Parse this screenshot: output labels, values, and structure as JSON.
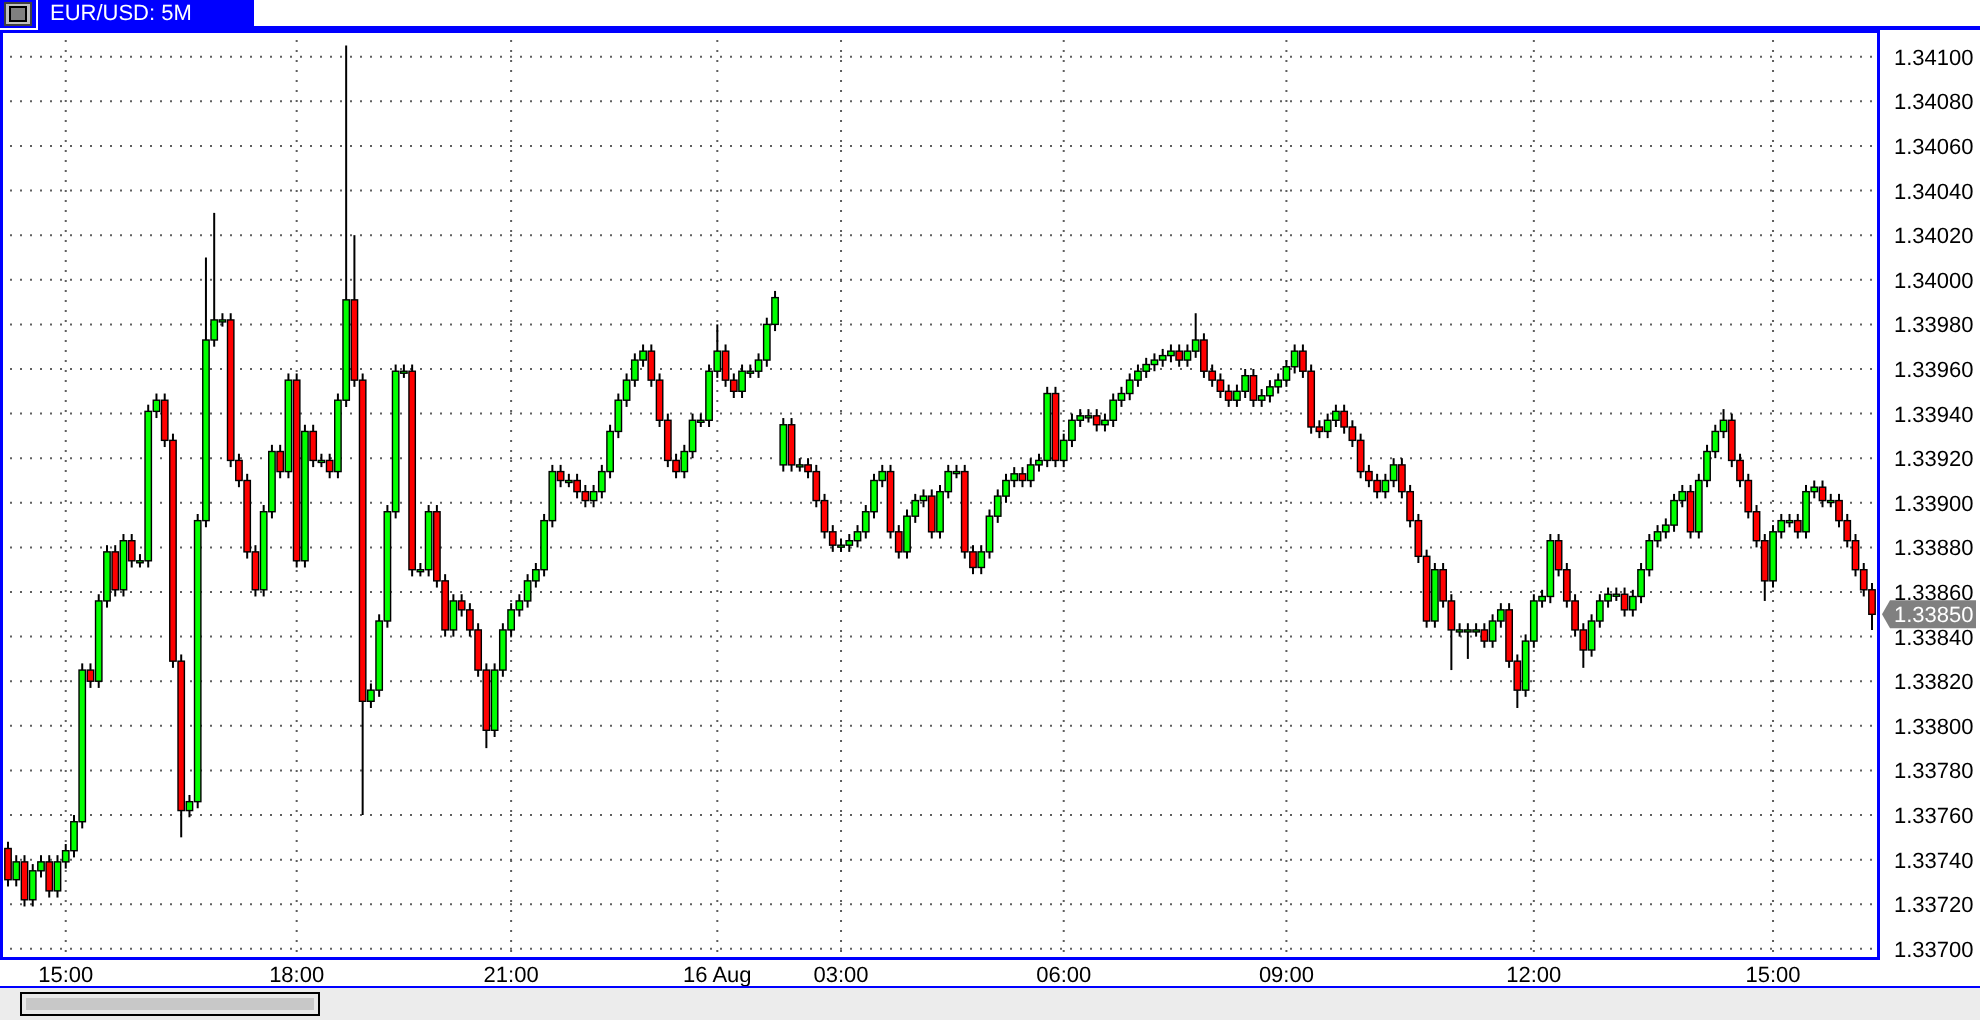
{
  "chart": {
    "title": "EUR/USD: 5M",
    "current_price": "1.33850",
    "chart_data": {
      "type": "candlestick",
      "grid": true,
      "ylim": [
        1.33695,
        1.34112
      ],
      "yticks": [
        {
          "value": 1.337,
          "label": "1.33700"
        },
        {
          "value": 1.3372,
          "label": "1.33720"
        },
        {
          "value": 1.3374,
          "label": "1.33740"
        },
        {
          "value": 1.3376,
          "label": "1.33760"
        },
        {
          "value": 1.3378,
          "label": "1.33780"
        },
        {
          "value": 1.338,
          "label": "1.33800"
        },
        {
          "value": 1.3382,
          "label": "1.33820"
        },
        {
          "value": 1.3384,
          "label": "1.33840"
        },
        {
          "value": 1.3386,
          "label": "1.33860"
        },
        {
          "value": 1.3388,
          "label": "1.33880"
        },
        {
          "value": 1.339,
          "label": "1.33900"
        },
        {
          "value": 1.3392,
          "label": "1.33920"
        },
        {
          "value": 1.3394,
          "label": "1.33940"
        },
        {
          "value": 1.3396,
          "label": "1.33960"
        },
        {
          "value": 1.3398,
          "label": "1.33980"
        },
        {
          "value": 1.34,
          "label": "1.34000"
        },
        {
          "value": 1.3402,
          "label": "1.34020"
        },
        {
          "value": 1.3404,
          "label": "1.34040"
        },
        {
          "value": 1.3406,
          "label": "1.34060"
        },
        {
          "value": 1.3408,
          "label": "1.34080"
        },
        {
          "value": 1.341,
          "label": "1.34100"
        }
      ],
      "categories": [
        null,
        null,
        null,
        null,
        null,
        null,
        null,
        "15:00",
        null,
        null,
        null,
        null,
        null,
        null,
        null,
        null,
        null,
        null,
        null,
        null,
        null,
        null,
        null,
        null,
        null,
        null,
        null,
        null,
        null,
        null,
        null,
        null,
        null,
        null,
        null,
        "18:00",
        null,
        null,
        null,
        null,
        null,
        null,
        null,
        null,
        null,
        null,
        null,
        null,
        null,
        null,
        null,
        null,
        null,
        null,
        null,
        null,
        null,
        null,
        null,
        null,
        null,
        "21:00",
        null,
        null,
        null,
        null,
        null,
        null,
        null,
        null,
        null,
        null,
        null,
        null,
        null,
        null,
        null,
        null,
        null,
        null,
        null,
        null,
        null,
        null,
        null,
        null,
        "16 Aug",
        null,
        null,
        null,
        null,
        null,
        null,
        null,
        null,
        null,
        null,
        null,
        null,
        null,
        null,
        "03:00",
        null,
        null,
        null,
        null,
        null,
        null,
        null,
        null,
        null,
        null,
        null,
        null,
        null,
        null,
        null,
        null,
        null,
        null,
        null,
        null,
        null,
        null,
        null,
        null,
        null,
        null,
        "06:00",
        null,
        null,
        null,
        null,
        null,
        null,
        null,
        null,
        null,
        null,
        null,
        null,
        null,
        null,
        null,
        null,
        null,
        null,
        null,
        null,
        null,
        null,
        null,
        null,
        null,
        null,
        "09:00",
        null,
        null,
        null,
        null,
        null,
        null,
        null,
        null,
        null,
        null,
        null,
        null,
        null,
        null,
        null,
        null,
        null,
        null,
        null,
        null,
        null,
        null,
        null,
        null,
        null,
        null,
        null,
        null,
        null,
        "12:00",
        null,
        null,
        null,
        null,
        null,
        null,
        null,
        null,
        null,
        null,
        null,
        null,
        null,
        null,
        null,
        null,
        null,
        null,
        null,
        null,
        null,
        null,
        null,
        null,
        null,
        null,
        null,
        null,
        "15:00",
        null,
        null,
        null,
        null,
        null,
        null,
        null,
        null,
        null,
        null,
        null,
        null
      ],
      "ohlc": [
        [
          1.33745,
          1.33748,
          1.33728,
          1.33731
        ],
        [
          1.33731,
          1.33742,
          1.33728,
          1.33739
        ],
        [
          1.33739,
          1.33742,
          1.33719,
          1.33722
        ],
        [
          1.33722,
          1.33738,
          1.33719,
          1.33735
        ],
        [
          1.33735,
          1.33742,
          1.33732,
          1.33739
        ],
        [
          1.33739,
          1.33742,
          1.33723,
          1.33726
        ],
        [
          1.33726,
          1.33742,
          1.33723,
          1.33739
        ],
        [
          1.33739,
          1.33747,
          1.33736,
          1.33744
        ],
        [
          1.33744,
          1.3376,
          1.33741,
          1.33757
        ],
        [
          1.33757,
          1.33828,
          1.33754,
          1.33825
        ],
        [
          1.33825,
          1.33828,
          1.33817,
          1.3382
        ],
        [
          1.3382,
          1.33859,
          1.33817,
          1.33856
        ],
        [
          1.33856,
          1.33881,
          1.33853,
          1.33878
        ],
        [
          1.33878,
          1.33881,
          1.33858,
          1.33861
        ],
        [
          1.33861,
          1.33886,
          1.33858,
          1.33883
        ],
        [
          1.33883,
          1.33886,
          1.33871,
          1.33874
        ],
        [
          1.33874,
          1.33877,
          1.33871,
          1.33874
        ],
        [
          1.33874,
          1.33944,
          1.33871,
          1.33941
        ],
        [
          1.33941,
          1.33949,
          1.33938,
          1.33946
        ],
        [
          1.33946,
          1.33949,
          1.33925,
          1.33928
        ],
        [
          1.33928,
          1.33931,
          1.33826,
          1.33829
        ],
        [
          1.33829,
          1.33832,
          1.3375,
          1.33762
        ],
        [
          1.33762,
          1.33769,
          1.33759,
          1.33766
        ],
        [
          1.33766,
          1.33895,
          1.33763,
          1.33892
        ],
        [
          1.33892,
          1.3401,
          1.33889,
          1.33973
        ],
        [
          1.33973,
          1.3403,
          1.3397,
          1.33982
        ],
        [
          1.33982,
          1.33985,
          1.33979,
          1.33982
        ],
        [
          1.33982,
          1.33985,
          1.33916,
          1.33919
        ],
        [
          1.33919,
          1.33922,
          1.33907,
          1.3391
        ],
        [
          1.3391,
          1.33913,
          1.33875,
          1.33878
        ],
        [
          1.33878,
          1.33881,
          1.33858,
          1.33861
        ],
        [
          1.33861,
          1.33899,
          1.33858,
          1.33896
        ],
        [
          1.33896,
          1.33926,
          1.33893,
          1.33923
        ],
        [
          1.33923,
          1.33926,
          1.33911,
          1.33914
        ],
        [
          1.33914,
          1.33958,
          1.33911,
          1.33955
        ],
        [
          1.33955,
          1.33958,
          1.33871,
          1.33874
        ],
        [
          1.33874,
          1.33935,
          1.33871,
          1.33932
        ],
        [
          1.33932,
          1.33935,
          1.33916,
          1.33919
        ],
        [
          1.33919,
          1.33922,
          1.33916,
          1.33919
        ],
        [
          1.33919,
          1.33922,
          1.33911,
          1.33914
        ],
        [
          1.33914,
          1.33949,
          1.33911,
          1.33946
        ],
        [
          1.33946,
          1.34105,
          1.33943,
          1.33991
        ],
        [
          1.33991,
          1.3402,
          1.33952,
          1.33955
        ],
        [
          1.33955,
          1.33958,
          1.3376,
          1.33811
        ],
        [
          1.33811,
          1.33819,
          1.33808,
          1.33816
        ],
        [
          1.33816,
          1.3385,
          1.33813,
          1.33847
        ],
        [
          1.33847,
          1.33899,
          1.33844,
          1.33896
        ],
        [
          1.33896,
          1.33962,
          1.33893,
          1.33959
        ],
        [
          1.33959,
          1.33962,
          1.33956,
          1.33959
        ],
        [
          1.33959,
          1.33962,
          1.33867,
          1.3387
        ],
        [
          1.3387,
          1.33873,
          1.33867,
          1.3387
        ],
        [
          1.3387,
          1.33899,
          1.33867,
          1.33896
        ],
        [
          1.33896,
          1.33899,
          1.33862,
          1.33865
        ],
        [
          1.33865,
          1.33868,
          1.3384,
          1.33843
        ],
        [
          1.33843,
          1.33859,
          1.3384,
          1.33856
        ],
        [
          1.33856,
          1.33859,
          1.33849,
          1.33852
        ],
        [
          1.33852,
          1.33855,
          1.3384,
          1.33843
        ],
        [
          1.33843,
          1.33846,
          1.33822,
          1.33825
        ],
        [
          1.33825,
          1.33828,
          1.3379,
          1.33798
        ],
        [
          1.33798,
          1.33828,
          1.33795,
          1.33825
        ],
        [
          1.33825,
          1.33846,
          1.33822,
          1.33843
        ],
        [
          1.33843,
          1.33855,
          1.3384,
          1.33852
        ],
        [
          1.33852,
          1.33859,
          1.33849,
          1.33856
        ],
        [
          1.33856,
          1.33868,
          1.33853,
          1.33865
        ],
        [
          1.33865,
          1.33873,
          1.33862,
          1.3387
        ],
        [
          1.3387,
          1.33895,
          1.33867,
          1.33892
        ],
        [
          1.33892,
          1.33917,
          1.33889,
          1.33914
        ],
        [
          1.33914,
          1.33917,
          1.33907,
          1.3391
        ],
        [
          1.3391,
          1.33913,
          1.33907,
          1.3391
        ],
        [
          1.3391,
          1.33913,
          1.33902,
          1.33905
        ],
        [
          1.33905,
          1.33908,
          1.33898,
          1.33901
        ],
        [
          1.33901,
          1.33908,
          1.33898,
          1.33905
        ],
        [
          1.33905,
          1.33917,
          1.33902,
          1.33914
        ],
        [
          1.33914,
          1.33935,
          1.33911,
          1.33932
        ],
        [
          1.33932,
          1.33949,
          1.33929,
          1.33946
        ],
        [
          1.33946,
          1.33958,
          1.33943,
          1.33955
        ],
        [
          1.33955,
          1.33967,
          1.33952,
          1.33964
        ],
        [
          1.33964,
          1.33971,
          1.33961,
          1.33968
        ],
        [
          1.33968,
          1.33971,
          1.33952,
          1.33955
        ],
        [
          1.33955,
          1.33958,
          1.33934,
          1.33937
        ],
        [
          1.33937,
          1.3394,
          1.33916,
          1.33919
        ],
        [
          1.33919,
          1.33922,
          1.33911,
          1.33914
        ],
        [
          1.33914,
          1.33926,
          1.33911,
          1.33923
        ],
        [
          1.33923,
          1.3394,
          1.3392,
          1.33937
        ],
        [
          1.33937,
          1.3394,
          1.33934,
          1.33937
        ],
        [
          1.33937,
          1.33962,
          1.33934,
          1.33959
        ],
        [
          1.33959,
          1.3398,
          1.33956,
          1.33968
        ],
        [
          1.33968,
          1.33971,
          1.33952,
          1.33955
        ],
        [
          1.33955,
          1.33958,
          1.33947,
          1.3395
        ],
        [
          1.3395,
          1.33962,
          1.33947,
          1.33959
        ],
        [
          1.33959,
          1.33962,
          1.33956,
          1.33959
        ],
        [
          1.33959,
          1.33967,
          1.33956,
          1.33964
        ],
        [
          1.33964,
          1.33983,
          1.33961,
          1.3398
        ],
        [
          1.3398,
          1.33995,
          1.33977,
          1.33992
        ],
        [
          1.33917,
          1.33938,
          1.33914,
          1.33935
        ],
        [
          1.33935,
          1.33938,
          1.33914,
          1.33917
        ],
        [
          1.33917,
          1.3392,
          1.33914,
          1.33917
        ],
        [
          1.33917,
          1.3392,
          1.33911,
          1.33914
        ],
        [
          1.33914,
          1.33917,
          1.33898,
          1.33901
        ],
        [
          1.33901,
          1.33904,
          1.33884,
          1.33887
        ],
        [
          1.33887,
          1.3389,
          1.33878,
          1.33881
        ],
        [
          1.33881,
          1.33884,
          1.33878,
          1.33881
        ],
        [
          1.33881,
          1.33886,
          1.33878,
          1.33883
        ],
        [
          1.33883,
          1.3389,
          1.3388,
          1.33887
        ],
        [
          1.33887,
          1.33899,
          1.33884,
          1.33896
        ],
        [
          1.33896,
          1.33913,
          1.33893,
          1.3391
        ],
        [
          1.3391,
          1.33917,
          1.33907,
          1.33914
        ],
        [
          1.33914,
          1.33917,
          1.33884,
          1.33887
        ],
        [
          1.33887,
          1.3389,
          1.33875,
          1.33878
        ],
        [
          1.33878,
          1.33897,
          1.33875,
          1.33894
        ],
        [
          1.33894,
          1.33904,
          1.33891,
          1.33901
        ],
        [
          1.33901,
          1.33906,
          1.33898,
          1.33903
        ],
        [
          1.33903,
          1.33906,
          1.33884,
          1.33887
        ],
        [
          1.33887,
          1.33908,
          1.33884,
          1.33905
        ],
        [
          1.33905,
          1.33917,
          1.33902,
          1.33914
        ],
        [
          1.33914,
          1.33917,
          1.33911,
          1.33914
        ],
        [
          1.33914,
          1.33917,
          1.33875,
          1.33878
        ],
        [
          1.33878,
          1.33881,
          1.33868,
          1.33871
        ],
        [
          1.33871,
          1.33881,
          1.33868,
          1.33878
        ],
        [
          1.33878,
          1.33897,
          1.33875,
          1.33894
        ],
        [
          1.33894,
          1.33906,
          1.33891,
          1.33903
        ],
        [
          1.33903,
          1.33913,
          1.339,
          1.3391
        ],
        [
          1.3391,
          1.33916,
          1.33907,
          1.33913
        ],
        [
          1.33913,
          1.33916,
          1.33907,
          1.3391
        ],
        [
          1.3391,
          1.3392,
          1.33907,
          1.33917
        ],
        [
          1.33917,
          1.33922,
          1.33914,
          1.33919
        ],
        [
          1.33919,
          1.33952,
          1.33916,
          1.33949
        ],
        [
          1.33949,
          1.33952,
          1.33916,
          1.33919
        ],
        [
          1.33919,
          1.33931,
          1.33916,
          1.33928
        ],
        [
          1.33928,
          1.3394,
          1.33925,
          1.33937
        ],
        [
          1.33937,
          1.33942,
          1.33934,
          1.33939
        ],
        [
          1.33939,
          1.33942,
          1.33936,
          1.33939
        ],
        [
          1.33939,
          1.33942,
          1.33932,
          1.33935
        ],
        [
          1.33935,
          1.3394,
          1.33932,
          1.33937
        ],
        [
          1.33937,
          1.33949,
          1.33934,
          1.33946
        ],
        [
          1.33946,
          1.33952,
          1.33943,
          1.33949
        ],
        [
          1.33949,
          1.33958,
          1.33946,
          1.33955
        ],
        [
          1.33955,
          1.33962,
          1.33952,
          1.33959
        ],
        [
          1.33959,
          1.33965,
          1.33956,
          1.33962
        ],
        [
          1.33962,
          1.33967,
          1.33959,
          1.33964
        ],
        [
          1.33964,
          1.33969,
          1.33961,
          1.33966
        ],
        [
          1.33966,
          1.33971,
          1.33963,
          1.33968
        ],
        [
          1.33968,
          1.33971,
          1.33961,
          1.33964
        ],
        [
          1.33964,
          1.33971,
          1.33961,
          1.33968
        ],
        [
          1.33968,
          1.33985,
          1.33965,
          1.33973
        ],
        [
          1.33973,
          1.33976,
          1.33956,
          1.33959
        ],
        [
          1.33959,
          1.33962,
          1.33952,
          1.33955
        ],
        [
          1.33955,
          1.33958,
          1.33947,
          1.3395
        ],
        [
          1.3395,
          1.33953,
          1.33943,
          1.33946
        ],
        [
          1.33946,
          1.33953,
          1.33943,
          1.3395
        ],
        [
          1.3395,
          1.3396,
          1.33947,
          1.33957
        ],
        [
          1.33957,
          1.3396,
          1.33943,
          1.33946
        ],
        [
          1.33946,
          1.33951,
          1.33943,
          1.33948
        ],
        [
          1.33948,
          1.33955,
          1.33945,
          1.33952
        ],
        [
          1.33952,
          1.33958,
          1.33949,
          1.33955
        ],
        [
          1.33955,
          1.33964,
          1.33952,
          1.33961
        ],
        [
          1.33961,
          1.33971,
          1.33958,
          1.33968
        ],
        [
          1.33968,
          1.33971,
          1.33956,
          1.33959
        ],
        [
          1.33959,
          1.33962,
          1.33931,
          1.33934
        ],
        [
          1.33934,
          1.33937,
          1.33929,
          1.33932
        ],
        [
          1.33932,
          1.3394,
          1.33929,
          1.33937
        ],
        [
          1.33937,
          1.33944,
          1.33934,
          1.33941
        ],
        [
          1.33941,
          1.33944,
          1.33931,
          1.33934
        ],
        [
          1.33934,
          1.33937,
          1.33925,
          1.33928
        ],
        [
          1.33928,
          1.33931,
          1.33911,
          1.33914
        ],
        [
          1.33914,
          1.33917,
          1.33907,
          1.3391
        ],
        [
          1.3391,
          1.33913,
          1.33902,
          1.33905
        ],
        [
          1.33905,
          1.33913,
          1.33902,
          1.3391
        ],
        [
          1.3391,
          1.3392,
          1.33907,
          1.33917
        ],
        [
          1.33917,
          1.3392,
          1.33902,
          1.33905
        ],
        [
          1.33905,
          1.33908,
          1.33889,
          1.33892
        ],
        [
          1.33892,
          1.33895,
          1.33873,
          1.33876
        ],
        [
          1.33876,
          1.33879,
          1.33844,
          1.33847
        ],
        [
          1.33847,
          1.33873,
          1.33844,
          1.3387
        ],
        [
          1.3387,
          1.33873,
          1.33853,
          1.33856
        ],
        [
          1.33856,
          1.33859,
          1.33825,
          1.33843
        ],
        [
          1.33843,
          1.33846,
          1.3384,
          1.33843
        ],
        [
          1.33843,
          1.33846,
          1.3383,
          1.33843
        ],
        [
          1.33843,
          1.33846,
          1.3384,
          1.33843
        ],
        [
          1.33843,
          1.33846,
          1.33835,
          1.33838
        ],
        [
          1.33838,
          1.3385,
          1.33835,
          1.33847
        ],
        [
          1.33847,
          1.33855,
          1.33844,
          1.33852
        ],
        [
          1.33852,
          1.33855,
          1.33826,
          1.33829
        ],
        [
          1.33829,
          1.33832,
          1.33808,
          1.33816
        ],
        [
          1.33816,
          1.33841,
          1.33813,
          1.33838
        ],
        [
          1.33838,
          1.33859,
          1.33835,
          1.33856
        ],
        [
          1.33856,
          1.33861,
          1.33853,
          1.33858
        ],
        [
          1.33858,
          1.33886,
          1.33855,
          1.33883
        ],
        [
          1.33883,
          1.33886,
          1.33867,
          1.3387
        ],
        [
          1.3387,
          1.33873,
          1.33853,
          1.33856
        ],
        [
          1.33856,
          1.33859,
          1.3384,
          1.33843
        ],
        [
          1.33843,
          1.33846,
          1.33826,
          1.33834
        ],
        [
          1.33834,
          1.3385,
          1.33831,
          1.33847
        ],
        [
          1.33847,
          1.33859,
          1.33844,
          1.33856
        ],
        [
          1.33856,
          1.33862,
          1.33853,
          1.33859
        ],
        [
          1.33859,
          1.33862,
          1.33856,
          1.33859
        ],
        [
          1.33859,
          1.33862,
          1.33849,
          1.33852
        ],
        [
          1.33852,
          1.33861,
          1.33849,
          1.33858
        ],
        [
          1.33858,
          1.33873,
          1.33855,
          1.3387
        ],
        [
          1.3387,
          1.33886,
          1.33867,
          1.33883
        ],
        [
          1.33883,
          1.3389,
          1.3388,
          1.33887
        ],
        [
          1.33887,
          1.33893,
          1.33884,
          1.3389
        ],
        [
          1.3389,
          1.33904,
          1.33887,
          1.33901
        ],
        [
          1.33901,
          1.33908,
          1.33898,
          1.33905
        ],
        [
          1.33905,
          1.33908,
          1.33884,
          1.33887
        ],
        [
          1.33887,
          1.33913,
          1.33884,
          1.3391
        ],
        [
          1.3391,
          1.33926,
          1.33907,
          1.33923
        ],
        [
          1.33923,
          1.33935,
          1.3392,
          1.33932
        ],
        [
          1.33932,
          1.33942,
          1.33929,
          1.33937
        ],
        [
          1.33937,
          1.3394,
          1.33916,
          1.33919
        ],
        [
          1.33919,
          1.33922,
          1.33907,
          1.3391
        ],
        [
          1.3391,
          1.33913,
          1.33893,
          1.33896
        ],
        [
          1.33896,
          1.33899,
          1.3388,
          1.33883
        ],
        [
          1.33883,
          1.33886,
          1.33856,
          1.33865
        ],
        [
          1.33865,
          1.3389,
          1.33862,
          1.33887
        ],
        [
          1.33887,
          1.33895,
          1.33884,
          1.33892
        ],
        [
          1.33892,
          1.33895,
          1.33889,
          1.33892
        ],
        [
          1.33892,
          1.33895,
          1.33884,
          1.33887
        ],
        [
          1.33887,
          1.33908,
          1.33884,
          1.33905
        ],
        [
          1.33905,
          1.3391,
          1.33902,
          1.33907
        ],
        [
          1.33907,
          1.3391,
          1.33898,
          1.33901
        ],
        [
          1.33901,
          1.33904,
          1.33898,
          1.33901
        ],
        [
          1.33901,
          1.33904,
          1.33889,
          1.33892
        ],
        [
          1.33892,
          1.33895,
          1.3388,
          1.33883
        ],
        [
          1.33883,
          1.33886,
          1.33867,
          1.3387
        ],
        [
          1.3387,
          1.33873,
          1.33858,
          1.33861
        ],
        [
          1.33861,
          1.33864,
          1.33843,
          1.3385
        ]
      ]
    }
  }
}
